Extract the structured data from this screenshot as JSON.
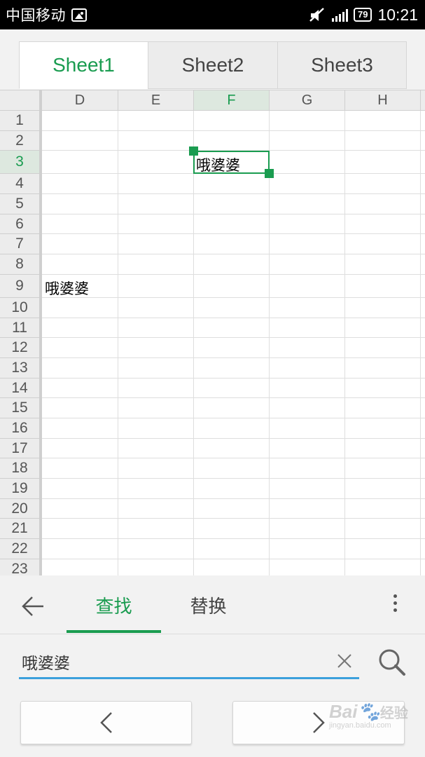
{
  "status_bar": {
    "carrier": "中国移动",
    "battery": "79",
    "time": "10:21"
  },
  "sheet_tabs": [
    {
      "label": "Sheet1",
      "active": true
    },
    {
      "label": "Sheet2",
      "active": false
    },
    {
      "label": "Sheet3",
      "active": false
    }
  ],
  "grid": {
    "columns": [
      "D",
      "E",
      "F",
      "G",
      "H"
    ],
    "selected_column": "F",
    "rows": [
      "1",
      "2",
      "3",
      "4",
      "5",
      "6",
      "7",
      "8",
      "9",
      "10",
      "11",
      "12",
      "13",
      "14",
      "15",
      "16",
      "17",
      "18",
      "19",
      "20",
      "21",
      "22",
      "23"
    ],
    "selected_row": "3",
    "cells": {
      "F3": "哦婆婆",
      "D9": "哦婆婆"
    }
  },
  "find_bar": {
    "tabs": [
      {
        "label": "查找",
        "active": true
      },
      {
        "label": "替换",
        "active": false
      }
    ]
  },
  "search": {
    "value": "哦婆婆"
  },
  "watermark": {
    "text": "Bai",
    "sub": "jingyan.baidu.com",
    "label": "经验"
  },
  "colors": {
    "accent": "#1a9c50",
    "input_underline": "#3ca0dc"
  }
}
